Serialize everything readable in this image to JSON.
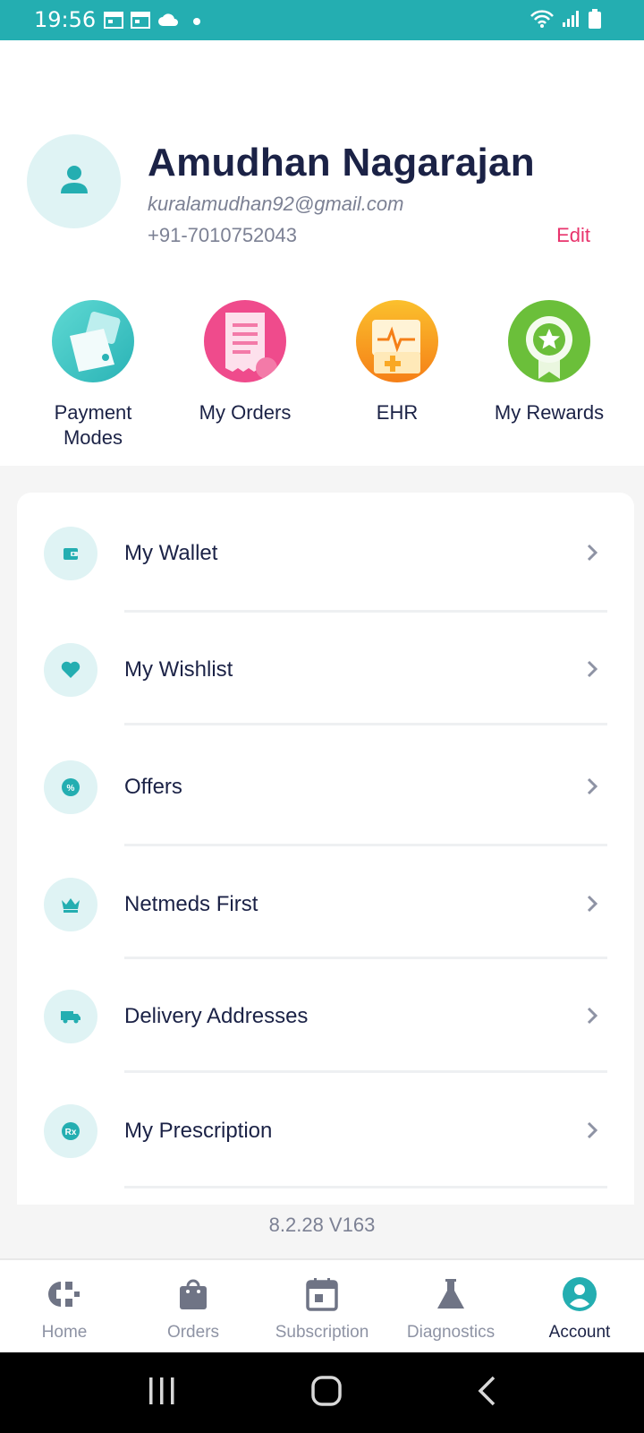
{
  "status_bar": {
    "time": "19:56",
    "left_icons": [
      "calendar-icon",
      "calendar-icon",
      "cloud-icon",
      "dot-icon"
    ],
    "right_icons": [
      "wifi-icon",
      "signal-icon",
      "battery-icon"
    ],
    "color": "#24aeb1"
  },
  "profile": {
    "name": "Amudhan Nagarajan",
    "email": "kuralamudhan92@gmail.com",
    "phone": "+91-7010752043",
    "edit_label": "Edit"
  },
  "quick_actions": [
    {
      "label": "Payment Modes",
      "icon": "wallet-icon",
      "color": "#3cc6c6"
    },
    {
      "label": "My Orders",
      "icon": "receipt-icon",
      "color": "#ef4b8c"
    },
    {
      "label": "EHR",
      "icon": "health-record-icon",
      "color": "#f9a825"
    },
    {
      "label": "My Rewards",
      "icon": "rewards-badge-icon",
      "color": "#6bbf3a"
    }
  ],
  "menu": {
    "items": [
      {
        "label": "My Wallet",
        "icon": "wallet-icon"
      },
      {
        "label": "My Wishlist",
        "icon": "heart-icon"
      },
      {
        "label": "Offers",
        "icon": "percent-badge-icon"
      },
      {
        "label": "Netmeds First",
        "icon": "crown-icon"
      },
      {
        "label": "Delivery Addresses",
        "icon": "truck-icon"
      },
      {
        "label": "My Prescription",
        "icon": "rx-icon"
      }
    ]
  },
  "version": "8.2.28 V163",
  "bottom_nav": {
    "items": [
      {
        "label": "Home",
        "icon": "home-icon"
      },
      {
        "label": "Orders",
        "icon": "bag-icon"
      },
      {
        "label": "Subscription",
        "icon": "calendar-icon"
      },
      {
        "label": "Diagnostics",
        "icon": "flask-icon"
      },
      {
        "label": "Account",
        "icon": "account-icon"
      }
    ],
    "active": "Account",
    "accent": "#24aeb1"
  },
  "system_nav": [
    "recents-icon",
    "home-circle-icon",
    "back-icon"
  ]
}
